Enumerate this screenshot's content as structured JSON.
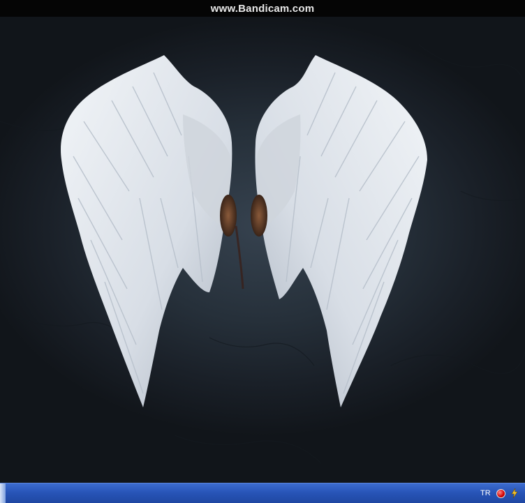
{
  "watermark": {
    "text": "www.Bandicam.com"
  },
  "taskbar": {
    "tray": {
      "language": "TR",
      "icons": [
        "record-icon",
        "lightning-icon"
      ]
    }
  },
  "colors": {
    "taskbar": "#2855b8",
    "wallpaper": "#26303a",
    "feather": "#e4e9ef"
  }
}
